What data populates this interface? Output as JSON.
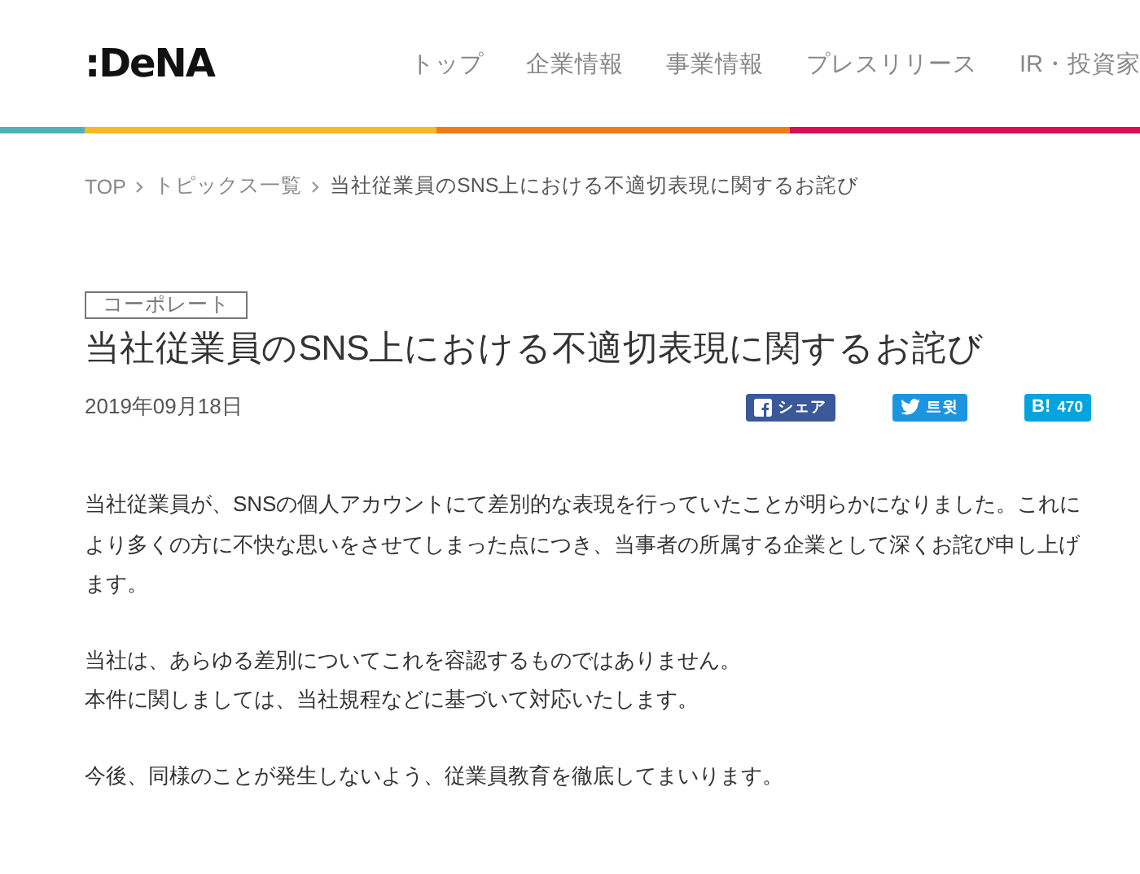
{
  "header": {
    "logo": ":DeNA",
    "nav": [
      {
        "label": "トップ"
      },
      {
        "label": "企業情報"
      },
      {
        "label": "事業情報"
      },
      {
        "label": "プレスリリース"
      },
      {
        "label": "IR・投資家"
      }
    ]
  },
  "breadcrumb": [
    "TOP",
    "トピックス一覧",
    "当社従業員のSNS上における不適切表現に関するお詫び"
  ],
  "article": {
    "category": "コーポレート",
    "title": "当社従業員のSNS上における不適切表現に関するお詫び",
    "date": "2019年09月18日",
    "share": [
      {
        "kind": "facebook",
        "label": "シェア"
      },
      {
        "kind": "twitter",
        "label": "트윗"
      },
      {
        "kind": "hatena",
        "icon_text": "B!",
        "label": "470"
      }
    ],
    "paragraphs": [
      [
        "当社従業員が、SNSの個人アカウントにて差別的な表現を行っていたことが明らかになりました。これにより多くの方に不快な思いをさせてしまった点につき、当事者の所属する企業として深くお詫び申し上げます。"
      ],
      [
        "当社は、あらゆる差別についてこれを容認するものではありません。",
        "本件に関しましては、当社規程などに基づいて対応いたします。"
      ],
      [
        "今後、同様のことが発生しないよう、従業員教育を徹底してまいります。"
      ]
    ]
  }
}
